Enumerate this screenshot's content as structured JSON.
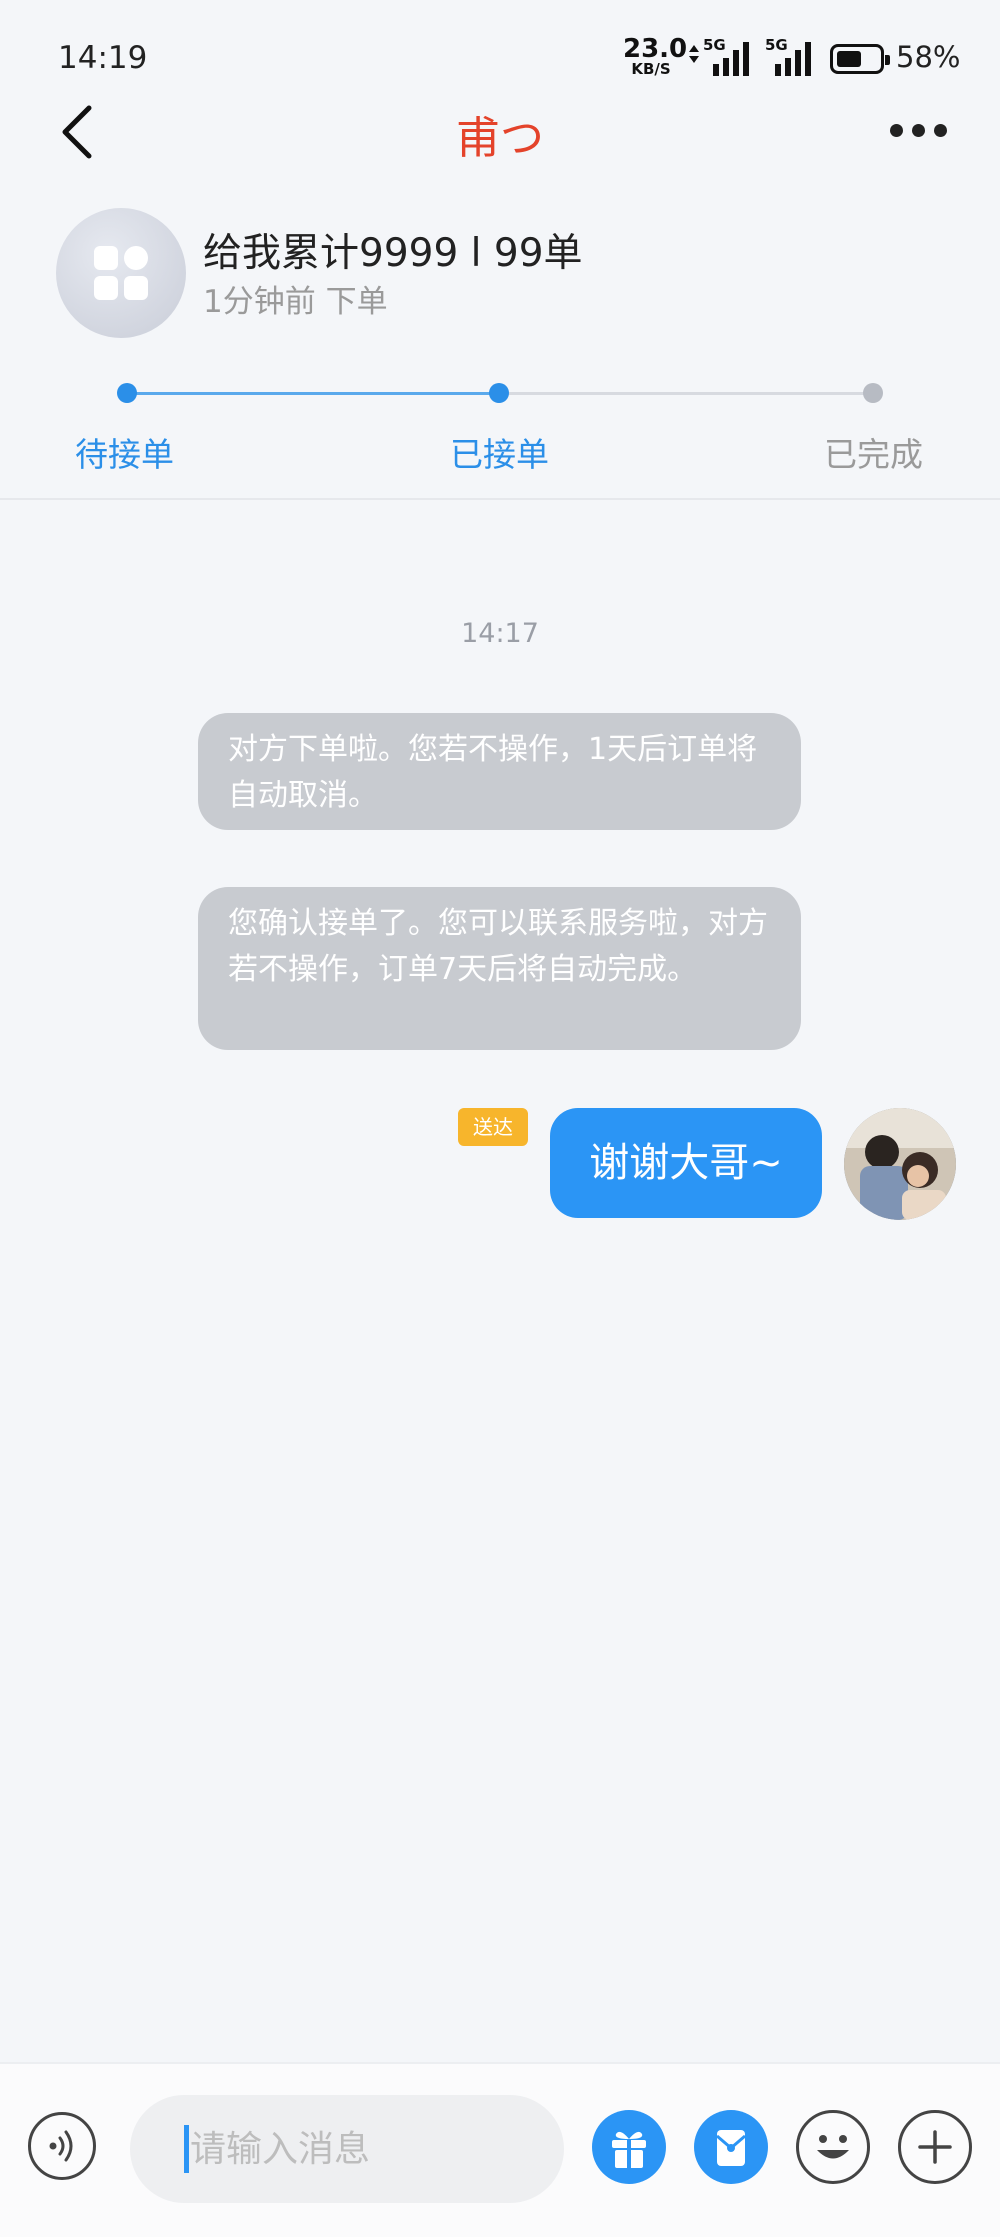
{
  "status_bar": {
    "time": "14:19",
    "net_speed_value": "23.0",
    "net_speed_unit": "KB/S",
    "sim1_label": "5G",
    "sim2_label": "5G",
    "battery_level": 0.58,
    "battery_text": "58%"
  },
  "nav": {
    "title": "甫つ",
    "title_color": "#e4432b",
    "back_icon": "chevron-left-icon",
    "more_icon": "more-horizontal-icon"
  },
  "order": {
    "title": "给我累计9999 l 99单",
    "subtitle": "1分钟前 下单",
    "avatar_icon": "app-grid-icon"
  },
  "progress": {
    "steps": [
      {
        "label": "待接单",
        "state": "done"
      },
      {
        "label": "已接单",
        "state": "current"
      },
      {
        "label": "已完成",
        "state": "pending"
      }
    ],
    "active_color": "#2b8fe8",
    "inactive_color": "#b7bbc3"
  },
  "chat": {
    "timestamp": "14:17",
    "system_messages": [
      "对方下单啦。您若不操作，1天后订单将自动取消。",
      "您确认接单了。您可以联系服务啦，对方若不操作，订单7天后将自动完成。"
    ],
    "my_message": {
      "text": "谢谢大哥~",
      "status": "送达",
      "bubble_color": "#2b95f5"
    }
  },
  "input_bar": {
    "placeholder": "请输入消息",
    "voice_icon": "voice-icon",
    "gift_icon": "gift-icon",
    "red_packet_icon": "red-packet-icon",
    "emoji_icon": "emoji-icon",
    "plus_icon": "plus-icon",
    "accent": "#2b95f5"
  }
}
